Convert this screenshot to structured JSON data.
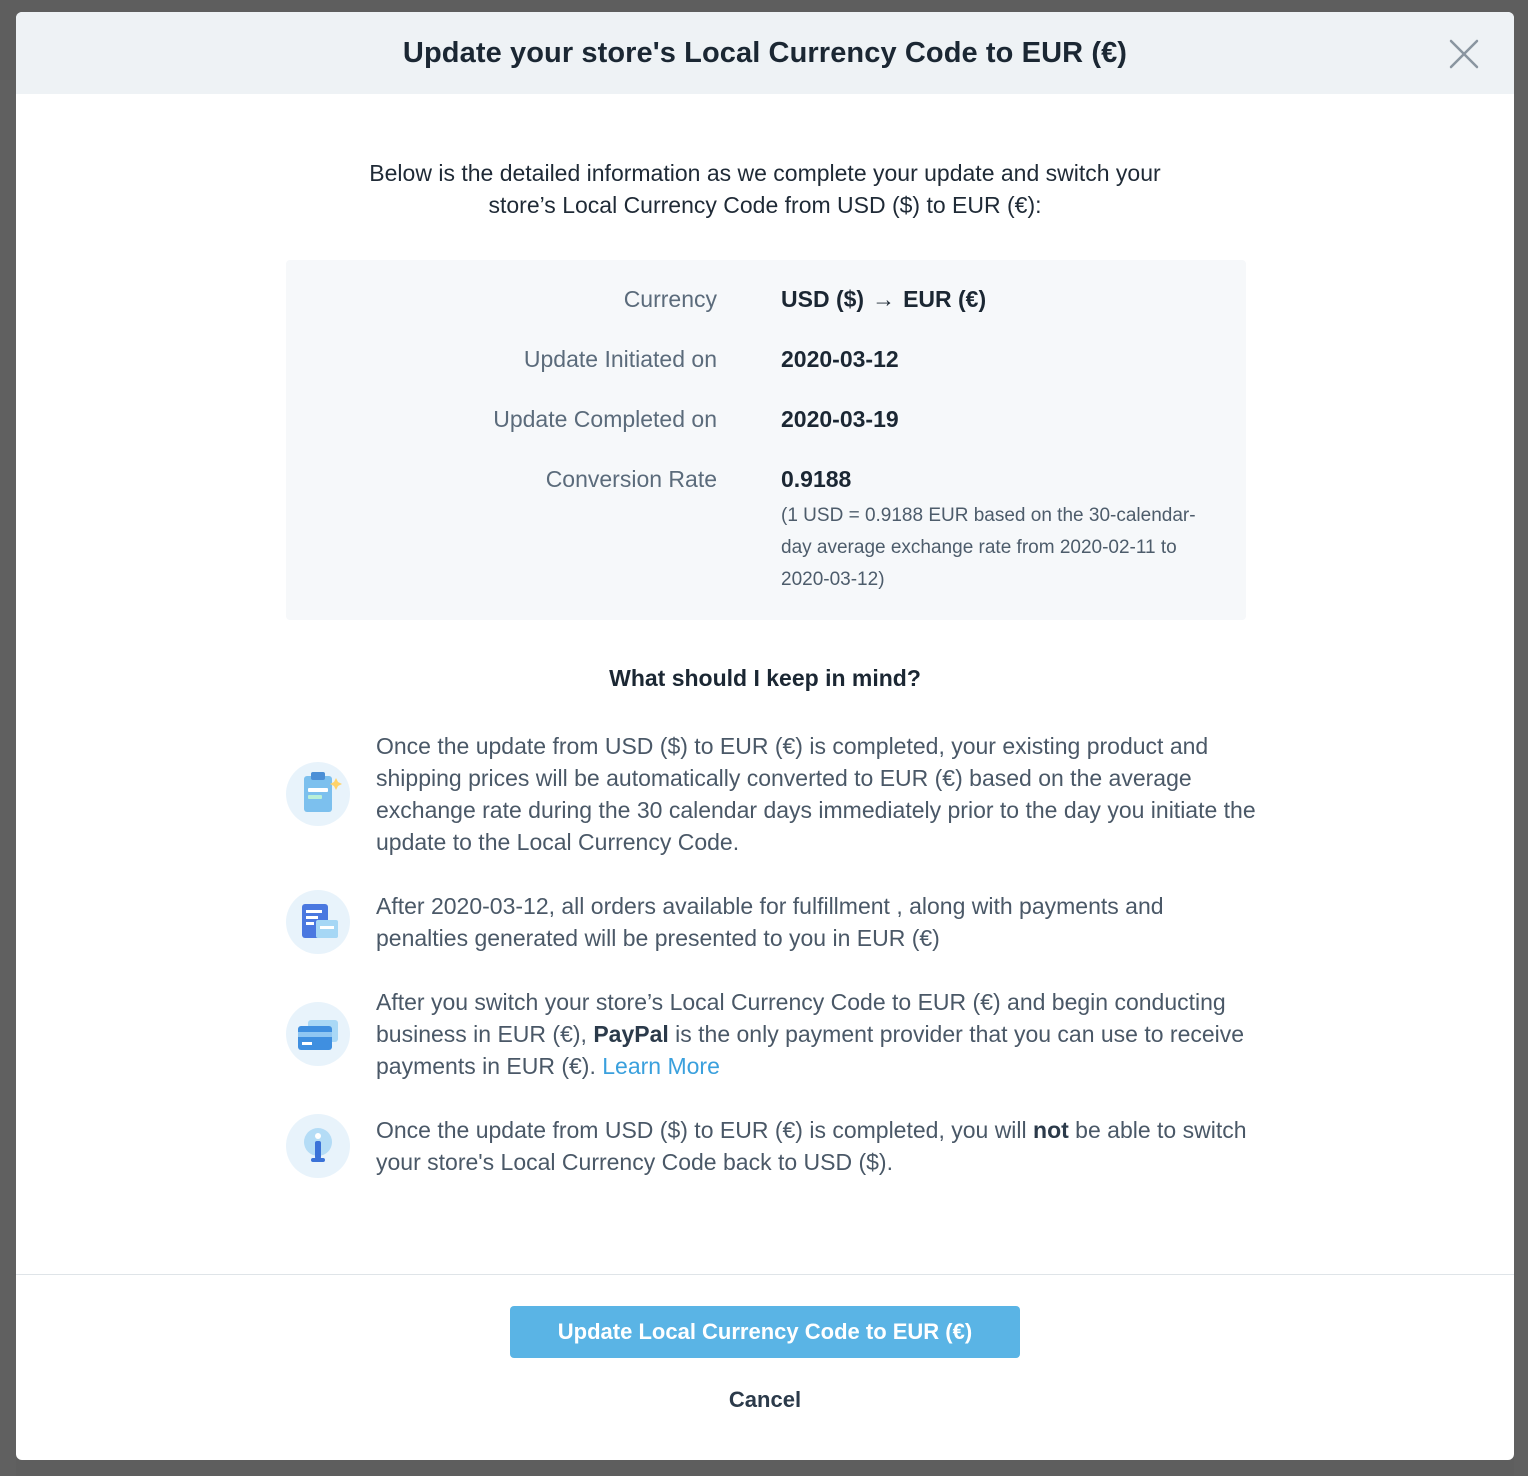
{
  "modal": {
    "title": "Update your store's Local Currency Code to EUR (€)",
    "close_icon": "close-icon"
  },
  "intro": {
    "line1": "Below is the detailed information as we complete your update and switch your",
    "line2": "store’s Local Currency Code from USD ($) to EUR (€):"
  },
  "details": {
    "currency_label": "Currency",
    "currency_from": "USD ($)",
    "currency_arrow": "→",
    "currency_to": "EUR (€)",
    "initiated_label": "Update Initiated on",
    "initiated_value": "2020-03-12",
    "completed_label": "Update Completed on",
    "completed_value": "2020-03-19",
    "rate_label": "Conversion Rate",
    "rate_value": "0.9188",
    "rate_note": "(1 USD = 0.9188 EUR based on the 30-calendar-day average exchange rate from 2020-02-11 to 2020-03-12)"
  },
  "tips": {
    "heading": "What should I keep in mind?",
    "items": [
      {
        "icon": "clipboard-icon",
        "text": "Once the update from USD ($) to EUR (€) is completed, your existing product and shipping prices will be automatically converted to EUR (€) based on the average exchange rate during the 30 calendar days immediately prior to the day you initiate the update to the Local Currency Code."
      },
      {
        "icon": "receipt-icon",
        "text": "After 2020-03-12, all orders available for fulfillment , along with payments and penalties generated will be presented to you in EUR (€)"
      },
      {
        "icon": "credit-card-icon",
        "text_before": "After you switch your store’s Local Currency Code to EUR (€) and begin conducting business in EUR (€), ",
        "bold": "PayPal",
        "text_after": " is the only payment provider that you can use to receive payments in EUR (€). ",
        "link": "Learn More"
      },
      {
        "icon": "info-icon",
        "text_before": "Once the update from USD ($) to EUR (€) is completed, you will ",
        "bold": "not",
        "text_after": " be able to switch your store's Local Currency Code back to USD ($)."
      }
    ]
  },
  "footer": {
    "primary_label": "Update Local Currency Code to EUR (€)",
    "cancel_label": "Cancel"
  },
  "colors": {
    "primary": "#5ab4e5",
    "link": "#3aa0dd",
    "header_bg": "#eef2f5",
    "overlay": "#5d5d5d"
  }
}
